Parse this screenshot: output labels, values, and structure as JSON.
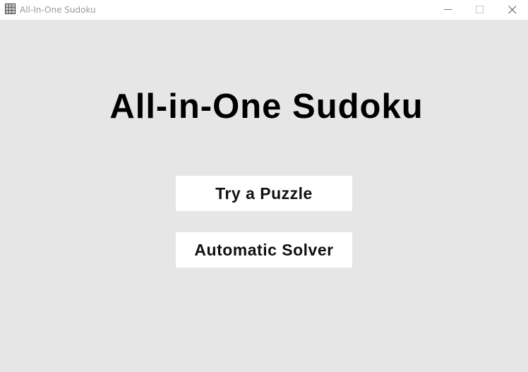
{
  "window": {
    "title": "All-In-One Sudoku",
    "icon": "sudoku-grid-icon"
  },
  "main": {
    "heading": "All-in-One Sudoku",
    "buttons": [
      {
        "label": "Try a Puzzle"
      },
      {
        "label": "Automatic Solver"
      }
    ]
  },
  "colors": {
    "background": "#e6e6e6",
    "titlebar": "#ffffff",
    "button": "#ffffff",
    "text": "#000000"
  }
}
